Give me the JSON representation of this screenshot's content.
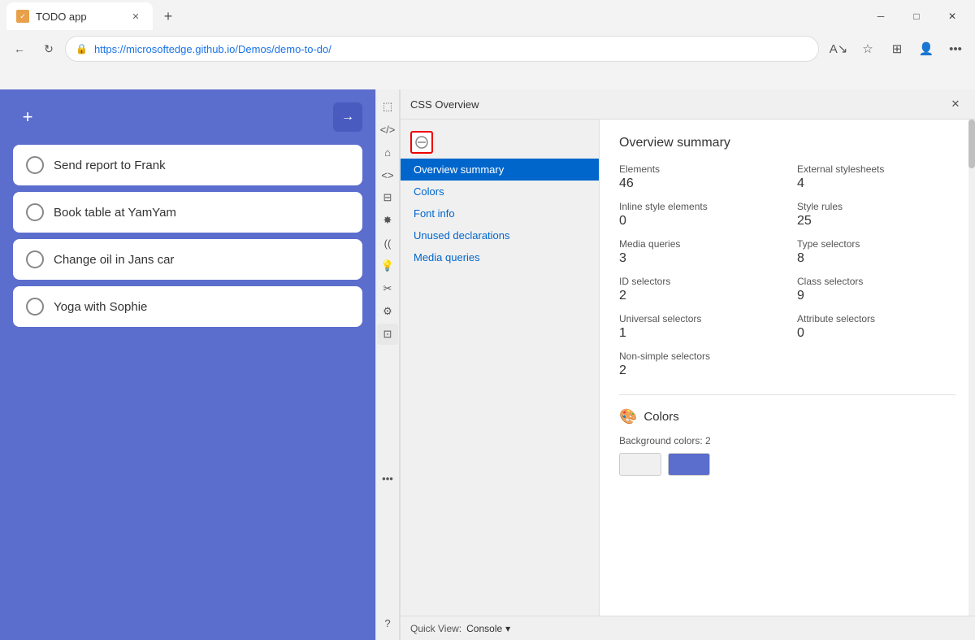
{
  "browser": {
    "tab_title": "TODO app",
    "tab_icon": "✓",
    "url_prefix": "https://microsoftedge.github.io",
    "url_path": "/Demos/demo-to-do/",
    "window_controls": {
      "minimize": "─",
      "maximize": "□",
      "close": "✕"
    }
  },
  "todo": {
    "add_btn": "+",
    "go_btn": "→",
    "items": [
      {
        "text": "Send report to Frank"
      },
      {
        "text": "Book table at YamYam"
      },
      {
        "text": "Change oil in Jans car"
      },
      {
        "text": "Yoga with Sophie"
      }
    ]
  },
  "devtools": {
    "icons": [
      "⬚",
      "</>",
      "⌂",
      "<>",
      "⊟",
      "✸",
      "((",
      "💡",
      "✂",
      "⚙",
      "⊡",
      "⊕"
    ],
    "bottom_icons": [
      "...",
      "?"
    ]
  },
  "css_overview": {
    "panel_title": "CSS Overview",
    "close_btn": "✕",
    "nav_items": [
      {
        "id": "overview-summary",
        "label": "Overview summary",
        "active": true
      },
      {
        "id": "colors",
        "label": "Colors",
        "active": false
      },
      {
        "id": "font-info",
        "label": "Font info",
        "active": false
      },
      {
        "id": "unused-declarations",
        "label": "Unused declarations",
        "active": false
      },
      {
        "id": "media-queries",
        "label": "Media queries",
        "active": false
      }
    ],
    "content": {
      "title": "Overview summary",
      "stats": [
        {
          "label": "Elements",
          "value": "46"
        },
        {
          "label": "External stylesheets",
          "value": "4"
        },
        {
          "label": "Inline style elements",
          "value": "0"
        },
        {
          "label": "Style rules",
          "value": "25"
        },
        {
          "label": "Media queries",
          "value": "3"
        },
        {
          "label": "Type selectors",
          "value": "8"
        },
        {
          "label": "ID selectors",
          "value": "2"
        },
        {
          "label": "Class selectors",
          "value": "9"
        },
        {
          "label": "Universal selectors",
          "value": "1"
        },
        {
          "label": "Attribute selectors",
          "value": "0"
        },
        {
          "label": "Non-simple selectors",
          "value": "2"
        }
      ],
      "colors_section": {
        "title": "Colors",
        "bg_label": "Background colors: 2",
        "swatches": [
          {
            "color": "#f0f0f0"
          },
          {
            "color": "#5b6dcd"
          }
        ]
      }
    }
  },
  "quick_view": {
    "label": "Quick View:",
    "selected": "Console",
    "dropdown_icon": "▾"
  }
}
